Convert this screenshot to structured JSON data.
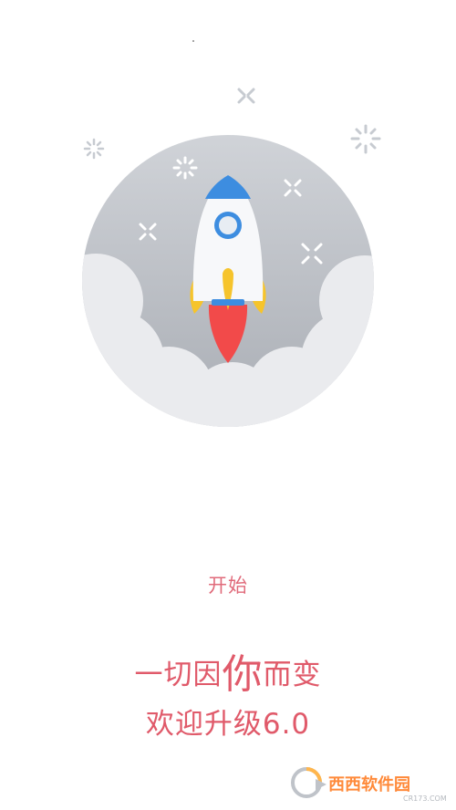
{
  "start_button": {
    "label": "开始"
  },
  "slogan": {
    "part1": "一切因",
    "emphasis": "你",
    "part2": "而变",
    "line2": "欢迎升级6.0"
  },
  "watermark": {
    "brand": "西西软件园",
    "domain": "CR173.COM"
  },
  "colors": {
    "accent": "#e05a6a",
    "circle": "#c4c8ce",
    "rocket_blue": "#3d8de0",
    "flame_yellow": "#f6c42c",
    "flame_red": "#f24a4a"
  }
}
